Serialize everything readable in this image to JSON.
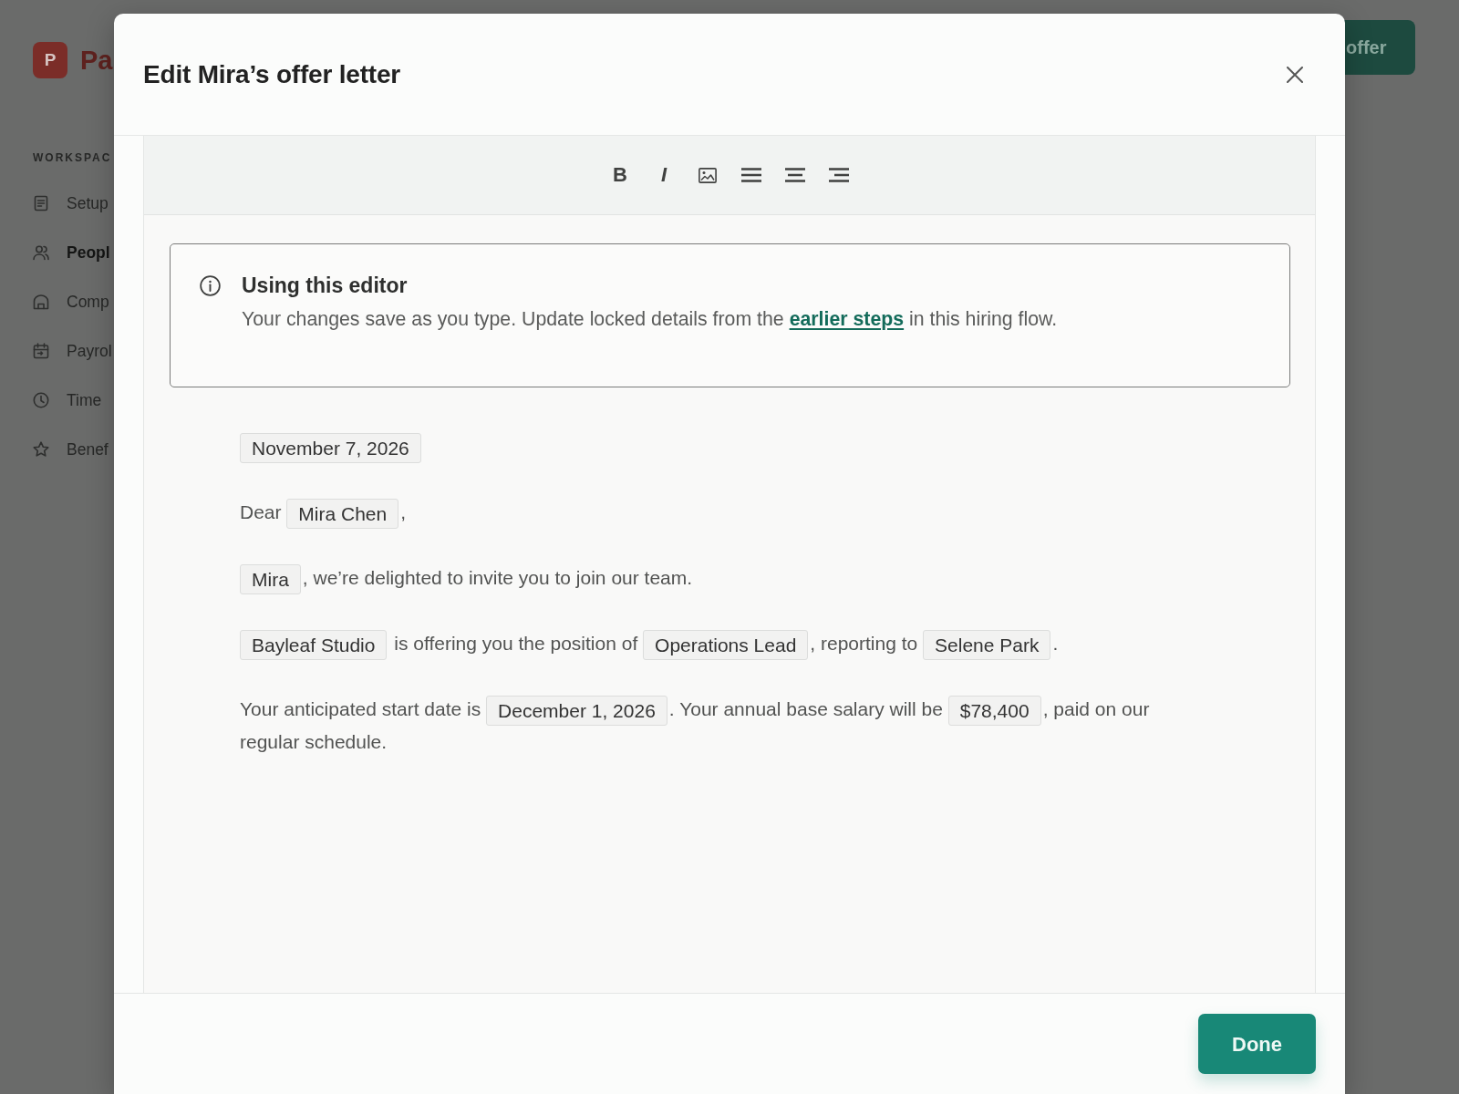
{
  "background": {
    "logo": {
      "mark": "P",
      "name": "Pa"
    },
    "sidebar": {
      "section": "WORKSPAC",
      "items": [
        {
          "label": "Setup",
          "selected": false
        },
        {
          "label": "Peopl",
          "selected": true
        },
        {
          "label": "Comp",
          "selected": false
        },
        {
          "label": "Payrol",
          "selected": false
        },
        {
          "label": "Time",
          "selected": false
        },
        {
          "label": "Benef",
          "selected": false
        }
      ]
    },
    "header_button": "offer"
  },
  "modal": {
    "title": "Edit Mira’s offer letter",
    "toolbar": [
      {
        "kind": "bold",
        "label": "B"
      },
      {
        "kind": "italic",
        "label": "I"
      },
      {
        "kind": "image"
      },
      {
        "kind": "justify"
      },
      {
        "kind": "center"
      },
      {
        "kind": "right"
      }
    ],
    "callout": {
      "title": "Using this editor",
      "text_before": "Your changes save as you type. Update locked details from the ",
      "link": "earlier steps",
      "text_after": " in this hiring flow."
    },
    "letter": {
      "paragraphs": [
        {
          "lines": [
            [
              {
                "kind": "field",
                "text": "November 7, 2026"
              }
            ]
          ]
        },
        {
          "lines": [
            [
              {
                "kind": "text",
                "text": "Dear "
              },
              {
                "kind": "field",
                "text": "Mira Chen"
              },
              {
                "kind": "text",
                "text": ","
              }
            ]
          ]
        },
        {
          "lines": [
            [
              {
                "kind": "field",
                "text": "Mira"
              },
              {
                "kind": "text",
                "text": ", we’re delighted to invite you to join our team."
              }
            ]
          ]
        },
        {
          "lines": [
            [
              {
                "kind": "field",
                "text": "Bayleaf Studio"
              },
              {
                "kind": "text",
                "text": " is offering you the position of "
              },
              {
                "kind": "field",
                "text": "Operations Lead"
              },
              {
                "kind": "text",
                "text": ", reporting to "
              },
              {
                "kind": "field",
                "text": "Selene Park"
              },
              {
                "kind": "text",
                "text": "."
              }
            ]
          ]
        },
        {
          "lines": [
            [
              {
                "kind": "text",
                "text": "Your anticipated start date is "
              },
              {
                "kind": "field",
                "text": "December 1, 2026"
              },
              {
                "kind": "text",
                "text": ". Your annual base salary will be "
              },
              {
                "kind": "field",
                "text": "$78,400"
              },
              {
                "kind": "text",
                "text": ", paid on our"
              }
            ],
            [
              {
                "kind": "text",
                "text": "regular schedule."
              }
            ]
          ]
        }
      ]
    },
    "footer": {
      "button": "Done"
    }
  }
}
